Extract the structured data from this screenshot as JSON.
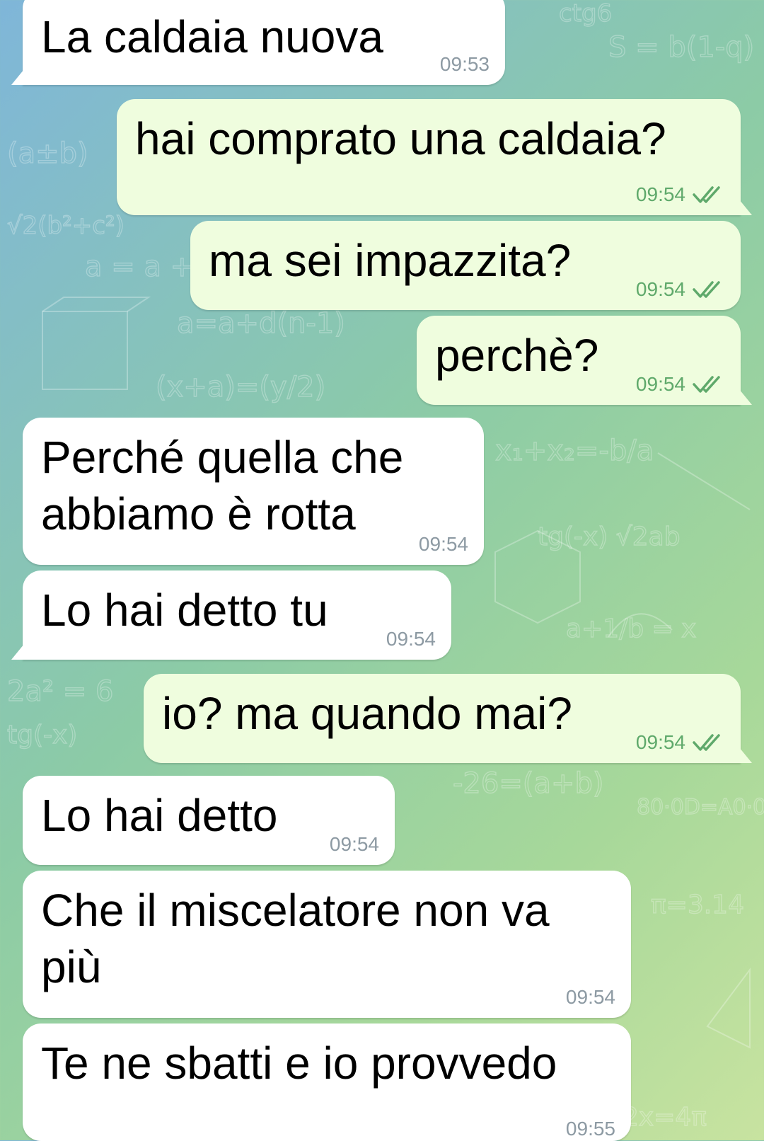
{
  "colors": {
    "incoming_bubble": "#ffffff",
    "outgoing_bubble": "#effdde",
    "incoming_time": "#8d9aa3",
    "outgoing_time": "#5fa96b"
  },
  "messages": [
    {
      "direction": "incoming",
      "text": "La caldaia nuova",
      "time": "09:53"
    },
    {
      "direction": "outgoing",
      "text": "hai comprato una caldaia?",
      "time": "09:54",
      "status": "read-double-check-icon"
    },
    {
      "direction": "outgoing",
      "text": "ma sei impazzita?",
      "time": "09:54",
      "status": "read-double-check-icon"
    },
    {
      "direction": "outgoing",
      "text": "perchè?",
      "time": "09:54",
      "status": "read-double-check-icon"
    },
    {
      "direction": "incoming",
      "text": "Perché quella che\nabbiamo è rotta",
      "time": "09:54"
    },
    {
      "direction": "incoming",
      "text": "Lo hai detto tu",
      "time": "09:54"
    },
    {
      "direction": "outgoing",
      "text": "io? ma quando mai?",
      "time": "09:54",
      "status": "read-double-check-icon"
    },
    {
      "direction": "incoming",
      "text": "Lo hai detto",
      "time": "09:54"
    },
    {
      "direction": "incoming",
      "text": "Che il miscelatore non va\npiù",
      "time": "09:54"
    },
    {
      "direction": "incoming",
      "text": "Te ne sbatti e io provvedo",
      "time": "09:55"
    }
  ]
}
